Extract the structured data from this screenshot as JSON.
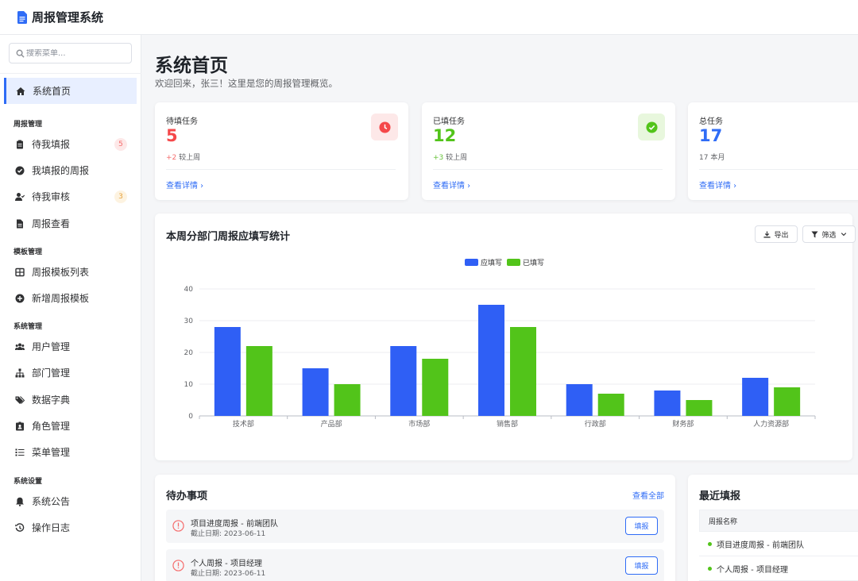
{
  "app": {
    "title": "周报管理系统"
  },
  "sidebar": {
    "search_placeholder": "搜索菜单...",
    "home": "系统首页",
    "groups": [
      {
        "title": "周报管理",
        "items": [
          {
            "label": "待我填报",
            "badge": "5",
            "icon": "clipboard-icon"
          },
          {
            "label": "我填报的周报",
            "icon": "check-circle-icon"
          },
          {
            "label": "待我审核",
            "badge": "3",
            "icon": "user-check-icon"
          },
          {
            "label": "周报查看",
            "icon": "file-icon"
          }
        ]
      },
      {
        "title": "模板管理",
        "items": [
          {
            "label": "周报模板列表",
            "icon": "table-icon"
          },
          {
            "label": "新增周报模板",
            "icon": "plus-circle-icon"
          }
        ]
      },
      {
        "title": "系统管理",
        "items": [
          {
            "label": "用户管理",
            "icon": "users-icon"
          },
          {
            "label": "部门管理",
            "icon": "sitemap-icon"
          },
          {
            "label": "数据字典",
            "icon": "tags-icon"
          },
          {
            "label": "角色管理",
            "icon": "id-badge-icon"
          },
          {
            "label": "菜单管理",
            "icon": "list-icon"
          }
        ]
      },
      {
        "title": "系统设置",
        "items": [
          {
            "label": "系统公告",
            "icon": "bell-icon"
          },
          {
            "label": "操作日志",
            "icon": "history-icon"
          }
        ]
      }
    ]
  },
  "header": {
    "title": "系统首页",
    "subtitle": "欢迎回来，张三！这里是您的周报管理概览。"
  },
  "stats": [
    {
      "label": "待填任务",
      "value": "5",
      "delta": "+2",
      "note": "较上周",
      "link": "查看详情",
      "color": "#f5484a",
      "icon": "clock-icon"
    },
    {
      "label": "已填任务",
      "value": "12",
      "delta": "+3",
      "note": "较上周",
      "link": "查看详情",
      "color": "#52c41a",
      "icon": "check-circle-icon"
    },
    {
      "label": "总任务",
      "value": "17",
      "delta": "17",
      "note": "本月",
      "link": "查看详情",
      "color": "#2f6cf6",
      "icon": ""
    }
  ],
  "chart": {
    "title": "本周分部门周报应填写统计",
    "export_label": "导出",
    "filter_label": "筛选"
  },
  "chart_data": {
    "type": "bar",
    "categories": [
      "技术部",
      "产品部",
      "市场部",
      "销售部",
      "行政部",
      "财务部",
      "人力资源部"
    ],
    "series": [
      {
        "name": "应填写",
        "values": [
          28,
          15,
          22,
          35,
          10,
          8,
          12
        ],
        "color": "#2f5ff5"
      },
      {
        "name": "已填写",
        "values": [
          22,
          10,
          18,
          28,
          7,
          5,
          9
        ],
        "color": "#52c41a"
      }
    ],
    "ylim": [
      0,
      40
    ],
    "yticks": [
      0,
      10,
      20,
      30,
      40
    ],
    "grid": true,
    "legend": "top-center",
    "title": "",
    "xlabel": "",
    "ylabel": ""
  },
  "todo": {
    "title": "待办事项",
    "view_all": "查看全部",
    "items": [
      {
        "title": "项目进度周报 - 前端团队",
        "date": "截止日期: 2023-06-11",
        "action": "填报"
      },
      {
        "title": "个人周报 - 项目经理",
        "date": "截止日期: 2023-06-11",
        "action": "填报"
      }
    ]
  },
  "recent": {
    "title": "最近填报",
    "column": "周报名称",
    "rows": [
      "项目进度周报 - 前端团队",
      "个人周报 - 项目经理"
    ]
  }
}
